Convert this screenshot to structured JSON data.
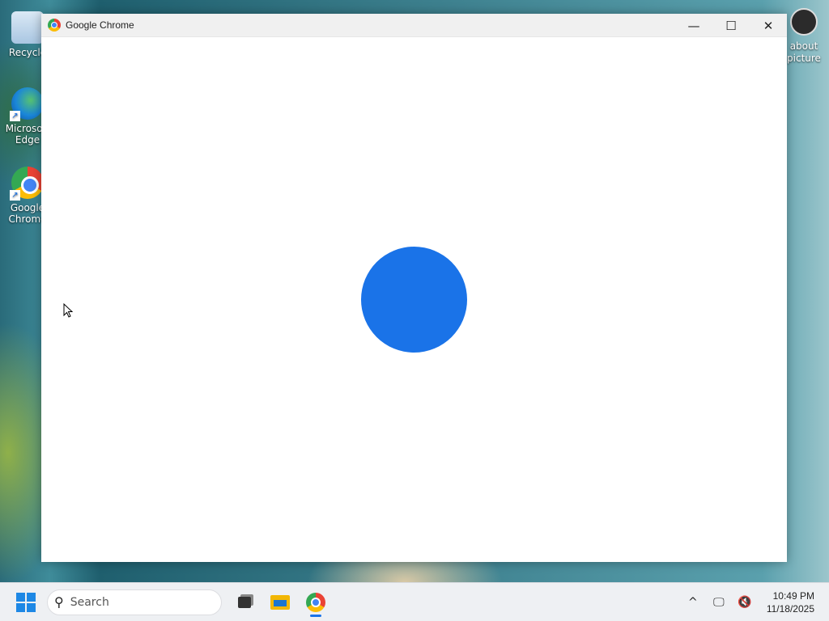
{
  "desktop": {
    "icons": [
      {
        "label": "Recycle",
        "icon": "recycle-bin-icon"
      },
      {
        "label": "Microsoft Edge",
        "icon": "edge-icon"
      },
      {
        "label": "Google Chrome",
        "icon": "chrome-icon"
      }
    ],
    "right_icon": {
      "label": "about picture",
      "icon": "info-icon"
    }
  },
  "window": {
    "title": "Google Chrome",
    "minimize_glyph": "—",
    "maximize_glyph": "☐",
    "close_glyph": "✕",
    "loading_color": "#1a73e8"
  },
  "taskbar": {
    "search_placeholder": "Search",
    "search_icon": "search-icon",
    "apps": [
      "task-view-icon",
      "file-explorer-icon",
      "chrome-icon"
    ],
    "tray_chevron": "^",
    "time": "10:49 PM",
    "date": "11/18/2025"
  }
}
